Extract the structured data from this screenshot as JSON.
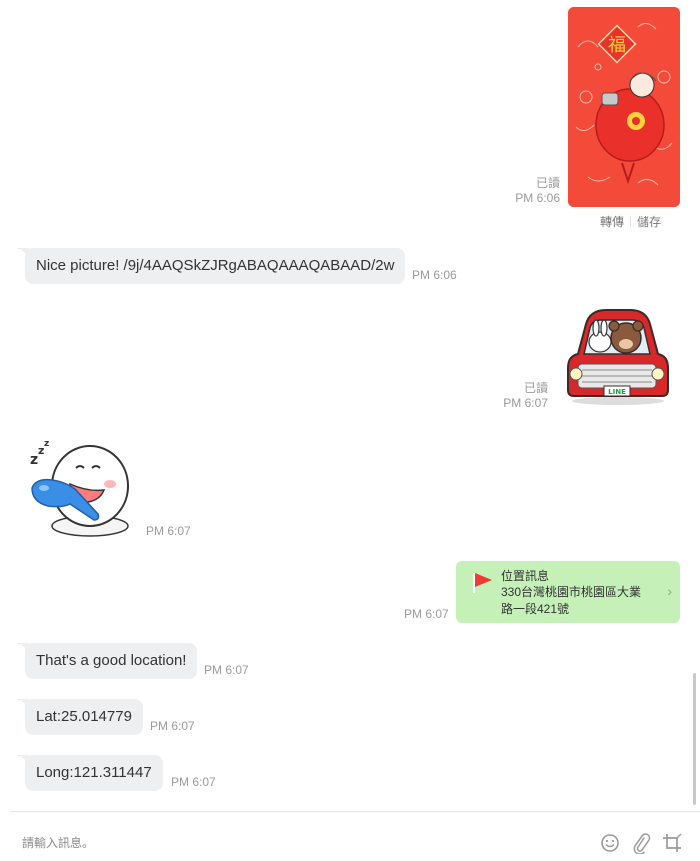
{
  "messages": {
    "photo": {
      "read": "已讀",
      "time": "PM 6:06",
      "forward": "轉傳",
      "save": "儲存"
    },
    "nice_picture": {
      "text": "Nice picture! /9j/4AAQSkZJRgABAQAAAQABAAD/2w",
      "time": "PM 6:06"
    },
    "car_sticker": {
      "read": "已讀",
      "time": "PM 6:07"
    },
    "sleep_sticker": {
      "time": "PM 6:07"
    },
    "location": {
      "title": "位置訊息",
      "address": "330台灣桃園市桃園區大業路一段421號",
      "time": "PM 6:07"
    },
    "good_location": {
      "text": "That's a good location!",
      "time": "PM 6:07"
    },
    "lat": {
      "text": "Lat:25.014779",
      "time": "PM 6:07"
    },
    "long": {
      "text": "Long:121.311447",
      "time": "PM 6:07"
    }
  },
  "input": {
    "placeholder": "請輸入訊息。",
    "value": ""
  },
  "icons": [
    "emoji-icon",
    "attach-icon",
    "crop-icon"
  ],
  "colors": {
    "bubble_in": "#eeeff1",
    "location_card": "#c5f0b7",
    "envelope": "#f44a3a",
    "meta_text": "#9a9a9a"
  }
}
